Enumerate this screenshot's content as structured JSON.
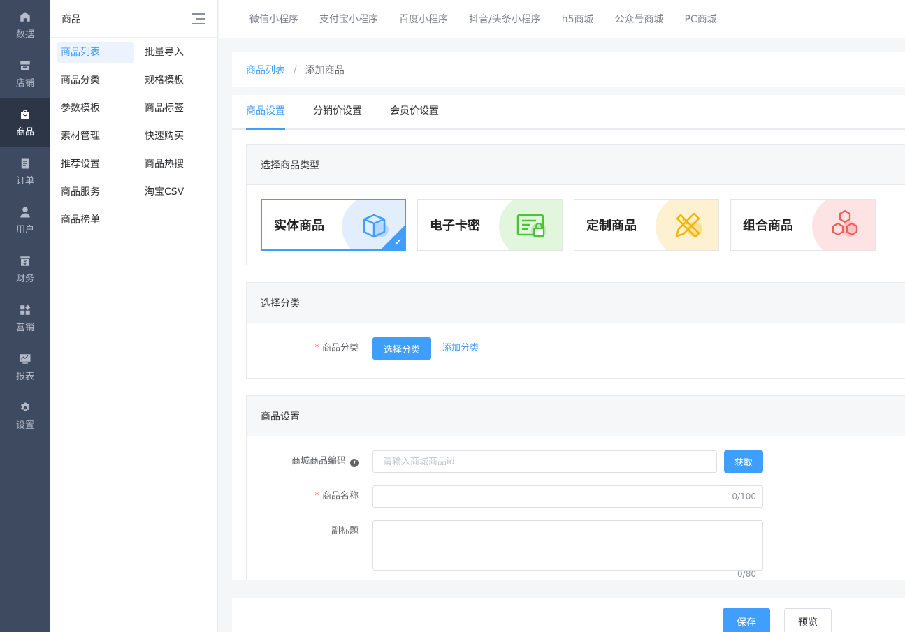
{
  "rail": {
    "items": [
      {
        "label": "数据",
        "icon": "home-icon"
      },
      {
        "label": "店铺",
        "icon": "store-icon"
      },
      {
        "label": "商品",
        "icon": "bag-icon"
      },
      {
        "label": "订单",
        "icon": "order-icon"
      },
      {
        "label": "用户",
        "icon": "user-icon"
      },
      {
        "label": "财务",
        "icon": "finance-icon"
      },
      {
        "label": "营销",
        "icon": "marketing-icon"
      },
      {
        "label": "报表",
        "icon": "report-icon"
      },
      {
        "label": "设置",
        "icon": "settings-icon"
      }
    ],
    "active": "商品"
  },
  "submenu": {
    "title": "商品",
    "links": [
      "商品列表",
      "批量导入",
      "商品分类",
      "规格模板",
      "参数模板",
      "商品标签",
      "素材管理",
      "快速购买",
      "推荐设置",
      "商品热搜",
      "商品服务",
      "淘宝CSV",
      "商品榜单"
    ],
    "active": "商品列表"
  },
  "topbar": {
    "tabs": [
      "微信小程序",
      "支付宝小程序",
      "百度小程序",
      "抖音/头条小程序",
      "h5商城",
      "公众号商城",
      "PC商城"
    ]
  },
  "breadcrumb": {
    "parent": "商品列表",
    "separator": "/",
    "current": "添加商品"
  },
  "tabs": {
    "items": [
      "商品设置",
      "分销价设置",
      "会员价设置"
    ],
    "active": "商品设置"
  },
  "product_type": {
    "title": "选择商品类型",
    "cards": [
      {
        "name": "实体商品",
        "icon": "box-icon",
        "color": "#409eff",
        "bg": "#e3eefc",
        "selected": true
      },
      {
        "name": "电子卡密",
        "icon": "card-lock-icon",
        "color": "#4cc23a",
        "bg": "#e2f6dd",
        "selected": false
      },
      {
        "name": "定制商品",
        "icon": "pencil-ruler-icon",
        "color": "#f5b400",
        "bg": "#fdf1d2",
        "selected": false
      },
      {
        "name": "组合商品",
        "icon": "hexagons-icon",
        "color": "#f25c5c",
        "bg": "#fde3e3",
        "selected": false
      }
    ]
  },
  "category": {
    "title": "选择分类",
    "label": "商品分类",
    "select_button": "选择分类",
    "add_link": "添加分类"
  },
  "settings": {
    "title": "商品设置",
    "code_label": "商城商品编码",
    "code_placeholder": "请输入商城商品id",
    "fetch_button": "获取",
    "name_label": "商品名称",
    "name_counter": "0/100",
    "subtitle_label": "副标题",
    "subtitle_counter": "0/80"
  },
  "footer": {
    "save": "保存",
    "preview": "预览"
  },
  "colors": {
    "accent": "#409eff",
    "rail_bg": "#3e4a5f",
    "required": "#f56c6c"
  }
}
